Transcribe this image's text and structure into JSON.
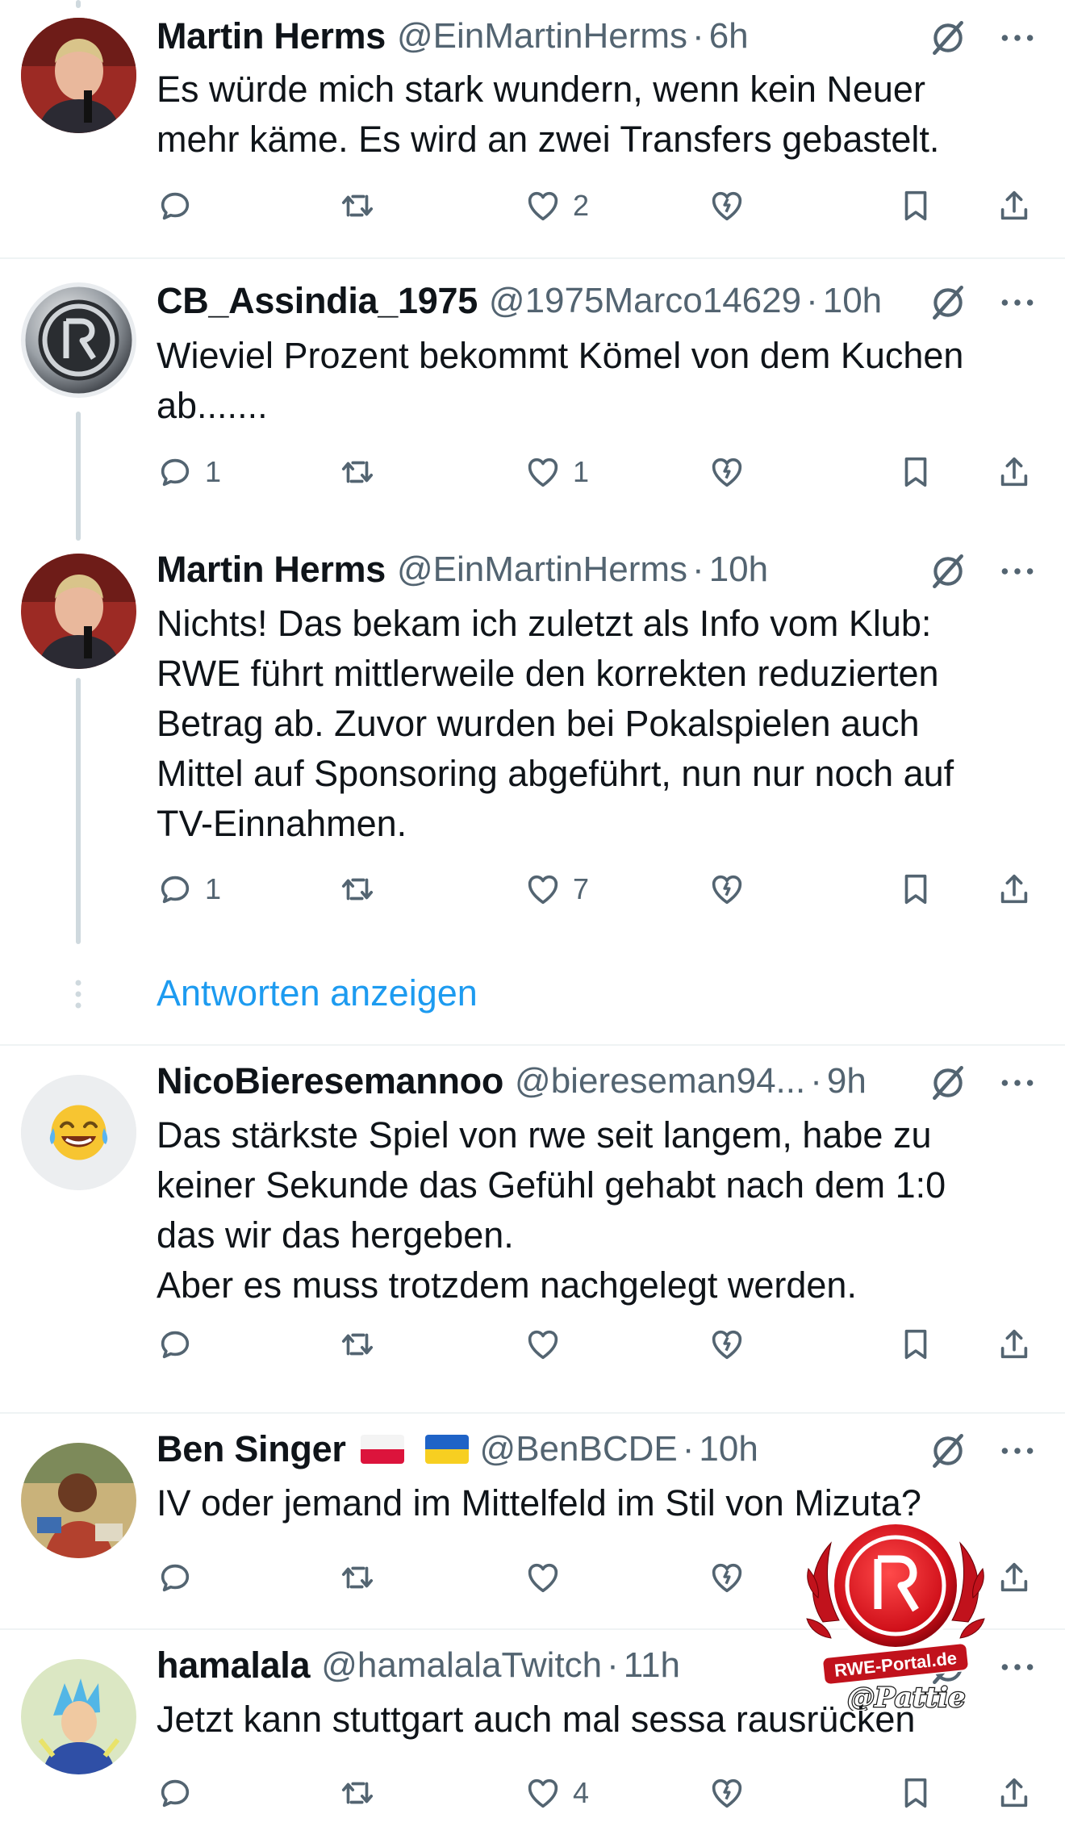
{
  "tweets": [
    {
      "name": "Martin Herms",
      "handle": "@EinMartinHerms",
      "sep": "·",
      "time": "6h",
      "text": "Es würde mich stark wundern, wenn kein Neuer\nmehr käme. Es wird an zwei Transfers gebastelt.",
      "replies": "",
      "retweets": "",
      "likes": "2"
    },
    {
      "name": "CB_Assindia_1975",
      "handle": "@1975Marco14629",
      "sep": "·",
      "time": "10h",
      "text": "Wieviel Prozent bekommt Kömel von dem Kuchen\nab.......",
      "replies": "1",
      "retweets": "",
      "likes": "1"
    },
    {
      "name": "Martin Herms",
      "handle": "@EinMartinHerms",
      "sep": "·",
      "time": "10h",
      "text": "Nichts! Das bekam ich zuletzt als Info vom Klub:\nRWE führt mittlerweile den korrekten reduzierten\nBetrag ab. Zuvor wurden bei Pokalspielen auch\nMittel auf Sponsoring abgeführt, nun nur noch auf\nTV-Einnahmen.",
      "replies": "1",
      "retweets": "",
      "likes": "7"
    },
    {
      "name": "NicoBieresemannoo",
      "handle": "@biereseman94...",
      "sep": "·",
      "time": "9h",
      "text": "Das stärkste Spiel von rwe seit langem, habe zu\nkeiner Sekunde das Gefühl gehabt nach dem 1:0\ndas wir das hergeben.\nAber es muss trotzdem nachgelegt werden.",
      "replies": "",
      "retweets": "",
      "likes": ""
    },
    {
      "name": "Ben Singer",
      "handle": "@BenBCDE",
      "sep": "·",
      "time": "10h",
      "text": "IV oder jemand im Mittelfeld im Stil von Mizuta?",
      "replies": "",
      "retweets": "",
      "likes": ""
    },
    {
      "name": "hamalala",
      "handle": "@hamalalaTwitch",
      "sep": "·",
      "time": "11h",
      "text": "Jetzt kann stuttgart auch mal sessa rausrücken",
      "replies": "",
      "retweets": "",
      "likes": "4"
    }
  ],
  "show_replies": "Antworten anzeigen",
  "watermark": {
    "brand": "RWE-Portal.de",
    "credit": "@Pattie"
  },
  "colors": {
    "link": "#1d9bf0",
    "secondary": "#536471",
    "divider": "#eff3f4",
    "watermark_red": "#d0101a"
  },
  "icons": {
    "reply": "reply-icon",
    "retweet": "retweet-icon",
    "like": "like-icon",
    "broken_heart": "broken-heart-icon",
    "bookmark": "bookmark-icon",
    "share": "share-icon",
    "grok": "grok-icon",
    "more": "more-icon"
  }
}
